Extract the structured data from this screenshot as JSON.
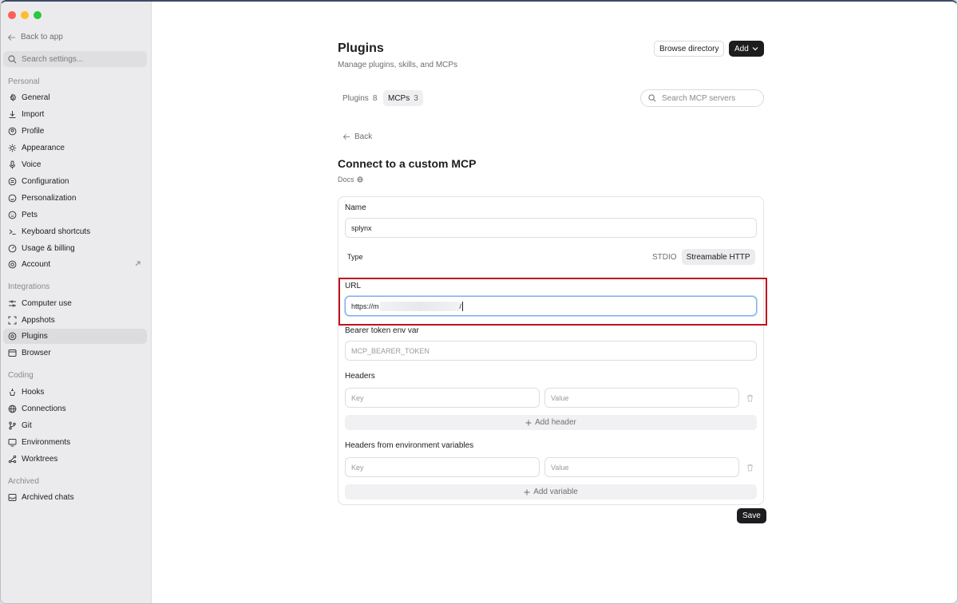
{
  "sidebar": {
    "back_label": "Back to app",
    "search_placeholder": "Search settings...",
    "sections": {
      "personal": "Personal",
      "integrations": "Integrations",
      "coding": "Coding",
      "archived": "Archived"
    },
    "personal_items": [
      {
        "label": "General",
        "icon": "gear-icon"
      },
      {
        "label": "Import",
        "icon": "download-icon"
      },
      {
        "label": "Profile",
        "icon": "profile-icon"
      },
      {
        "label": "Appearance",
        "icon": "sun-icon"
      },
      {
        "label": "Voice",
        "icon": "mic-icon"
      },
      {
        "label": "Configuration",
        "icon": "sliders-icon"
      },
      {
        "label": "Personalization",
        "icon": "smile-icon"
      },
      {
        "label": "Pets",
        "icon": "paw-icon"
      },
      {
        "label": "Keyboard shortcuts",
        "icon": "keyboard-icon"
      },
      {
        "label": "Usage & billing",
        "icon": "gauge-icon"
      },
      {
        "label": "Account",
        "icon": "account-icon"
      }
    ],
    "integration_items": [
      {
        "label": "Computer use",
        "icon": "cursor-icon"
      },
      {
        "label": "Appshots",
        "icon": "frame-icon"
      },
      {
        "label": "Plugins",
        "icon": "plug-icon",
        "active": true
      },
      {
        "label": "Browser",
        "icon": "browser-icon"
      }
    ],
    "coding_items": [
      {
        "label": "Hooks",
        "icon": "hook-icon"
      },
      {
        "label": "Connections",
        "icon": "globe-icon"
      },
      {
        "label": "Git",
        "icon": "git-branch-icon"
      },
      {
        "label": "Environments",
        "icon": "monitor-icon"
      },
      {
        "label": "Worktrees",
        "icon": "tree-icon"
      }
    ],
    "archived_items": [
      {
        "label": "Archived chats",
        "icon": "archive-icon"
      }
    ]
  },
  "header": {
    "title": "Plugins",
    "subtitle": "Manage plugins, skills, and MCPs",
    "browse_label": "Browse directory",
    "add_label": "Add"
  },
  "tabs": [
    {
      "label": "Plugins",
      "count": "8"
    },
    {
      "label": "MCPs",
      "count": "3",
      "active": true
    }
  ],
  "mcp_search_placeholder": "Search MCP servers",
  "form": {
    "back_label": "Back",
    "title": "Connect to a custom MCP",
    "docs_label": "Docs",
    "name_label": "Name",
    "name_value": "splynx",
    "type_label": "Type",
    "type_options": [
      "STDIO",
      "Streamable HTTP"
    ],
    "type_selected": "Streamable HTTP",
    "url_label": "URL",
    "url_value_prefix": "https://m",
    "url_value_suffix": "/",
    "bearer_label": "Bearer token env var",
    "bearer_placeholder": "MCP_BEARER_TOKEN",
    "headers_label": "Headers",
    "key_placeholder": "Key",
    "value_placeholder": "Value",
    "add_header_label": "Add header",
    "env_headers_label": "Headers from environment variables",
    "add_variable_label": "Add variable",
    "save_label": "Save"
  },
  "colors": {
    "highlight_border": "#c0121b",
    "focus_ring": "#7db0ea",
    "dark_button": "#1d1d1f"
  }
}
